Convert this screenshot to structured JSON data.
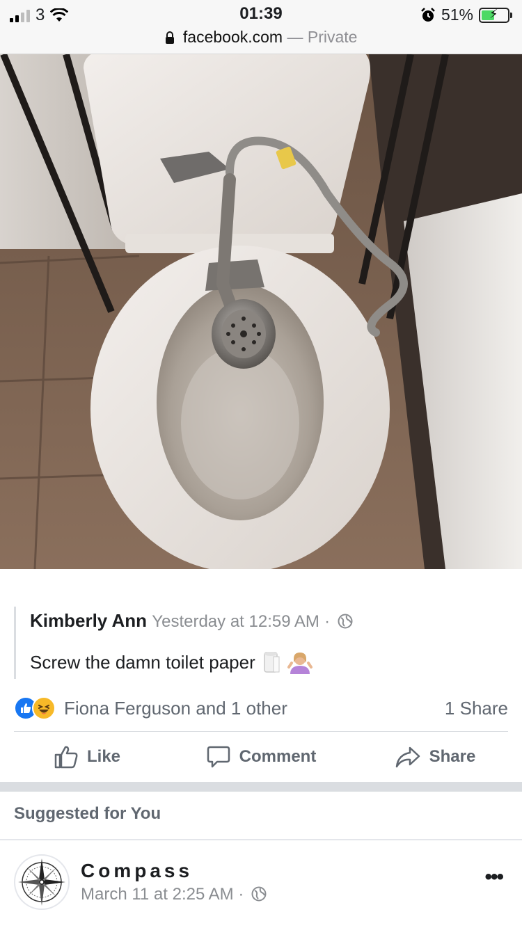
{
  "status_bar": {
    "carrier": "3",
    "time": "01:39",
    "battery": "51%",
    "battery_level": 0.51
  },
  "browser": {
    "domain": "facebook.com",
    "separator": "—",
    "mode": "Private"
  },
  "post": {
    "author": "Kimberly Ann",
    "timestamp": "Yesterday at 12:59 AM",
    "dot": "·",
    "text": "Screw the damn toilet paper",
    "emojis": [
      "toilet-paper-icon",
      "person-shrugging-icon"
    ]
  },
  "reactions": {
    "summary": "Fiona Ferguson and 1 other",
    "shares": "1 Share",
    "types": [
      "like",
      "haha"
    ]
  },
  "actions": {
    "like": "Like",
    "comment": "Comment",
    "share": "Share"
  },
  "suggested": {
    "heading": "Suggested for You",
    "page_name": "Compass",
    "page_time": "March 11 at 2:25 AM",
    "dot": "·",
    "more": "•••"
  },
  "colors": {
    "facebook_blue": "#1877f2",
    "haha_yellow": "#f7b928",
    "secondary_text": "#606770"
  }
}
